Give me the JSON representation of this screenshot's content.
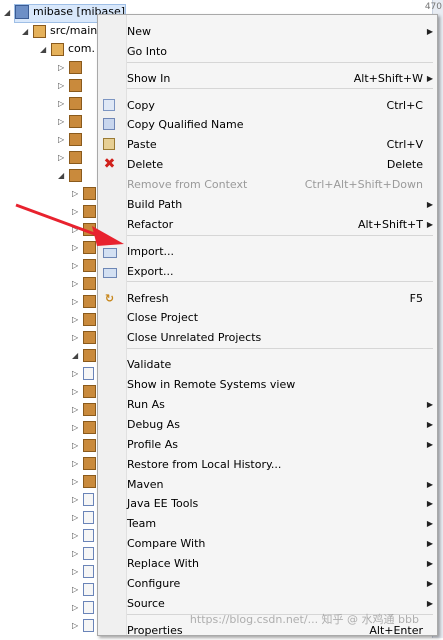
{
  "tree": {
    "root_label": "mibase [mibase]",
    "src_label": "src/main",
    "pkg_label": "com."
  },
  "right_edge_text": "470",
  "menu": {
    "items": [
      {
        "label": "New",
        "accel": "",
        "submenu": true,
        "icon": "",
        "disabled": false
      },
      {
        "label": "Go Into",
        "accel": "",
        "submenu": false,
        "icon": "",
        "disabled": false
      },
      {
        "label": "Show In",
        "accel": "Alt+Shift+W",
        "submenu": true,
        "icon": "",
        "disabled": false
      },
      {
        "label": "Copy",
        "accel": "Ctrl+C",
        "submenu": false,
        "icon": "copy-icon",
        "disabled": false
      },
      {
        "label": "Copy Qualified Name",
        "accel": "",
        "submenu": false,
        "icon": "copy-qualified-name-icon",
        "disabled": false
      },
      {
        "label": "Paste",
        "accel": "Ctrl+V",
        "submenu": false,
        "icon": "paste-icon",
        "disabled": false
      },
      {
        "label": "Delete",
        "accel": "Delete",
        "submenu": false,
        "icon": "delete-icon",
        "disabled": false
      },
      {
        "label": "Remove from Context",
        "accel": "Ctrl+Alt+Shift+Down",
        "submenu": false,
        "icon": "",
        "disabled": true
      },
      {
        "label": "Build Path",
        "accel": "",
        "submenu": true,
        "icon": "",
        "disabled": false
      },
      {
        "label": "Refactor",
        "accel": "Alt+Shift+T",
        "submenu": true,
        "icon": "",
        "disabled": false
      },
      {
        "label": "Import...",
        "accel": "",
        "submenu": false,
        "icon": "import-icon",
        "disabled": false
      },
      {
        "label": "Export...",
        "accel": "",
        "submenu": false,
        "icon": "export-icon",
        "disabled": false
      },
      {
        "label": "Refresh",
        "accel": "F5",
        "submenu": false,
        "icon": "refresh-icon",
        "disabled": false
      },
      {
        "label": "Close Project",
        "accel": "",
        "submenu": false,
        "icon": "",
        "disabled": false
      },
      {
        "label": "Close Unrelated Projects",
        "accel": "",
        "submenu": false,
        "icon": "",
        "disabled": false
      },
      {
        "label": "Validate",
        "accel": "",
        "submenu": false,
        "icon": "",
        "disabled": false
      },
      {
        "label": "Show in Remote Systems view",
        "accel": "",
        "submenu": false,
        "icon": "",
        "disabled": false
      },
      {
        "label": "Run As",
        "accel": "",
        "submenu": true,
        "icon": "",
        "disabled": false
      },
      {
        "label": "Debug As",
        "accel": "",
        "submenu": true,
        "icon": "",
        "disabled": false
      },
      {
        "label": "Profile As",
        "accel": "",
        "submenu": true,
        "icon": "",
        "disabled": false
      },
      {
        "label": "Restore from Local History...",
        "accel": "",
        "submenu": false,
        "icon": "",
        "disabled": false
      },
      {
        "label": "Maven",
        "accel": "",
        "submenu": true,
        "icon": "",
        "disabled": false
      },
      {
        "label": "Java EE Tools",
        "accel": "",
        "submenu": true,
        "icon": "",
        "disabled": false
      },
      {
        "label": "Team",
        "accel": "",
        "submenu": true,
        "icon": "",
        "disabled": false
      },
      {
        "label": "Compare With",
        "accel": "",
        "submenu": true,
        "icon": "",
        "disabled": false
      },
      {
        "label": "Replace With",
        "accel": "",
        "submenu": true,
        "icon": "",
        "disabled": false
      },
      {
        "label": "Configure",
        "accel": "",
        "submenu": true,
        "icon": "",
        "disabled": false
      },
      {
        "label": "Source",
        "accel": "",
        "submenu": true,
        "icon": "",
        "disabled": false
      },
      {
        "label": "Properties",
        "accel": "Alt+Enter",
        "submenu": false,
        "icon": "",
        "disabled": false
      }
    ]
  },
  "watermark": "https://blog.csdn.net/... 知乎 @ 水鸡通 bbb",
  "colors": {
    "arrow": "#e8222e",
    "menu_bg": "#f5f5f5"
  }
}
